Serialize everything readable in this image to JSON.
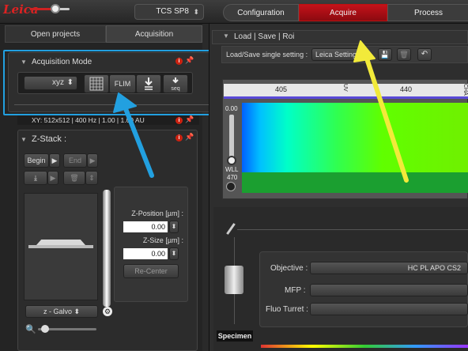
{
  "topbar": {
    "logo": "Leica",
    "system_select": "TCS SP8",
    "tabs": [
      "Configuration",
      "Acquire",
      "Process"
    ]
  },
  "left_tabs": [
    "Open projects",
    "Acquisition"
  ],
  "acq_mode": {
    "title": "Acquisition Mode",
    "mode_select": "xyz",
    "flim_label": "FLIM",
    "seq_label": "seq"
  },
  "scan_info": "XY: 512x512 | 400 Hz | 1.00 | 1.00 AU",
  "zstack": {
    "title": "Z-Stack :",
    "begin_label": "Begin",
    "end_label": "End",
    "zpos_label": "Z-Position [µm] :",
    "zpos_value": "0.00",
    "zsize_label": "Z-Size [µm] :",
    "zsize_value": "0.00",
    "recenter_label": "Re-Center",
    "galvo_select": "z - Galvo"
  },
  "load_save": {
    "title": "Load | Save | Roi",
    "setting_label": "Load/Save single setting :",
    "setting_value": "Leica Settings"
  },
  "spectrum": {
    "scale_labels": [
      "405",
      "440"
    ],
    "uv_label": "UV",
    "cha_label": "CHA",
    "value_top": "0.00",
    "wll_label": "WLL",
    "wll_value": "470"
  },
  "beampath": {
    "objective_label": "Objective :",
    "objective_value": "HC PL APO CS2",
    "mfp_label": "MFP :",
    "fluo_label": "Fluo Turret :",
    "specimen_label": "Specimen"
  },
  "colors": {
    "accent_red": "#c4121a",
    "blue_annotation": "#22a0e0",
    "yellow_annotation": "#f2ea3a"
  }
}
